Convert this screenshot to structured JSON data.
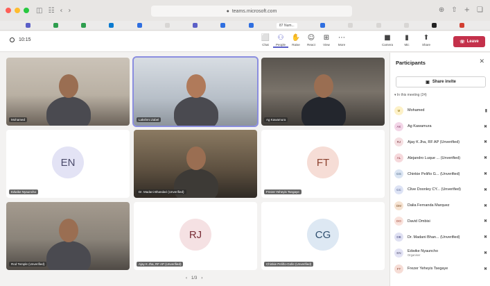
{
  "browser": {
    "url": "teams.microsoft.com",
    "active_tab": "87 Num..."
  },
  "meeting": {
    "elapsed": "10:15",
    "tools": [
      {
        "label": "Chat",
        "icon": "chat-icon",
        "glyph": "⬜"
      },
      {
        "label": "People",
        "icon": "people-icon",
        "glyph": "⚇"
      },
      {
        "label": "Raise",
        "icon": "raise-hand-icon",
        "glyph": "✋"
      },
      {
        "label": "React",
        "icon": "react-icon",
        "glyph": "☺"
      },
      {
        "label": "View",
        "icon": "view-icon",
        "glyph": "⊞"
      },
      {
        "label": "More",
        "icon": "more-icon",
        "glyph": "⋯"
      }
    ],
    "controls": [
      {
        "label": "Camera",
        "icon": "camera-icon",
        "glyph": "■"
      },
      {
        "label": "Mic",
        "icon": "mic-icon",
        "glyph": "▮"
      },
      {
        "label": "Share",
        "icon": "share-icon",
        "glyph": "⬆"
      }
    ],
    "leave_label": "Leave",
    "pager": "1/3"
  },
  "tiles": [
    {
      "name": "Mohamed",
      "type": "video",
      "style": "v1"
    },
    {
      "name": "Lakshmi Zabel",
      "type": "video",
      "style": "v2",
      "selected": true
    },
    {
      "name": "Ag Kawamura",
      "type": "video",
      "style": "v3"
    },
    {
      "name": "Edwike Nyauncho",
      "type": "avatar",
      "initials": "EN",
      "bg": "#e3e3f5",
      "fg": "#4b4b6b"
    },
    {
      "name": "Dr. Madani Bhandari (Unverified)",
      "type": "video",
      "style": "v4"
    },
    {
      "name": "Frezer Yeheyis Tsegaye",
      "type": "avatar",
      "initials": "FT",
      "bg": "#f6ddd6",
      "fg": "#8a3f2c"
    },
    {
      "name": "Rod Temple (Unverified)",
      "type": "video",
      "style": "v5"
    },
    {
      "name": "Ajay K Jha, RF AP (Unverified)",
      "type": "avatar",
      "initials": "RJ",
      "bg": "#f5e1e3",
      "fg": "#7a2f38"
    },
    {
      "name": "Chinkie Peliño-Golle (Unverified)",
      "type": "avatar",
      "initials": "CG",
      "bg": "#dde8f3",
      "fg": "#2f4f6f"
    }
  ],
  "panel": {
    "title": "Participants",
    "share_invite": "Share invite",
    "in_meeting": "In this meeting (24)",
    "participants": [
      {
        "initials": "M",
        "name": "Mohamed",
        "sub": "",
        "bg": "#fdf1c7",
        "fg": "#8a6d00",
        "mic": "▮"
      },
      {
        "initials": "AK",
        "name": "Ag Kawamura",
        "sub": "",
        "bg": "#f3d6e8",
        "fg": "#7a2f5b",
        "mic": "✖"
      },
      {
        "initials": "RJ",
        "name": "Ajay K Jha, RF AP (Unverified)",
        "sub": "",
        "bg": "#f5dfe2",
        "fg": "#7a2f38",
        "mic": "✖"
      },
      {
        "initials": "AL",
        "name": "Alejandro Luque ... (Unverified)",
        "sub": "",
        "bg": "#f6d9dc",
        "fg": "#8a2f3b",
        "mic": "✖"
      },
      {
        "initials": "CG",
        "name": "Chinkie Peliño G... (Unverified)",
        "sub": "",
        "bg": "#dbe5f3",
        "fg": "#2f4f6f",
        "mic": "✖"
      },
      {
        "initials": "CC",
        "name": "Clive Doonley CY... (Unverified)",
        "sub": "",
        "bg": "#dde3f5",
        "fg": "#34457a",
        "mic": "✖"
      },
      {
        "initials": "DM",
        "name": "Dalia Fernanda Marquez",
        "sub": "",
        "bg": "#f6e3d2",
        "fg": "#7a4a1f",
        "mic": "✖"
      },
      {
        "initials": "DO",
        "name": "David Ombisi",
        "sub": "",
        "bg": "#f9e2dc",
        "fg": "#9b3b2a",
        "mic": "✖"
      },
      {
        "initials": "DB",
        "name": "Dr. Madani Bhan... (Unverified)",
        "sub": "",
        "bg": "#e0e1f3",
        "fg": "#3a3d78",
        "mic": "✖"
      },
      {
        "initials": "EN",
        "name": "Edwike Nyauncho",
        "sub": "Organiser",
        "bg": "#e3e3f5",
        "fg": "#4b4b6b",
        "mic": "✖"
      },
      {
        "initials": "FT",
        "name": "Frezer Yeheyis Tsegaye",
        "sub": "",
        "bg": "#f6ddd6",
        "fg": "#8a3f2c",
        "mic": "✖"
      }
    ]
  }
}
